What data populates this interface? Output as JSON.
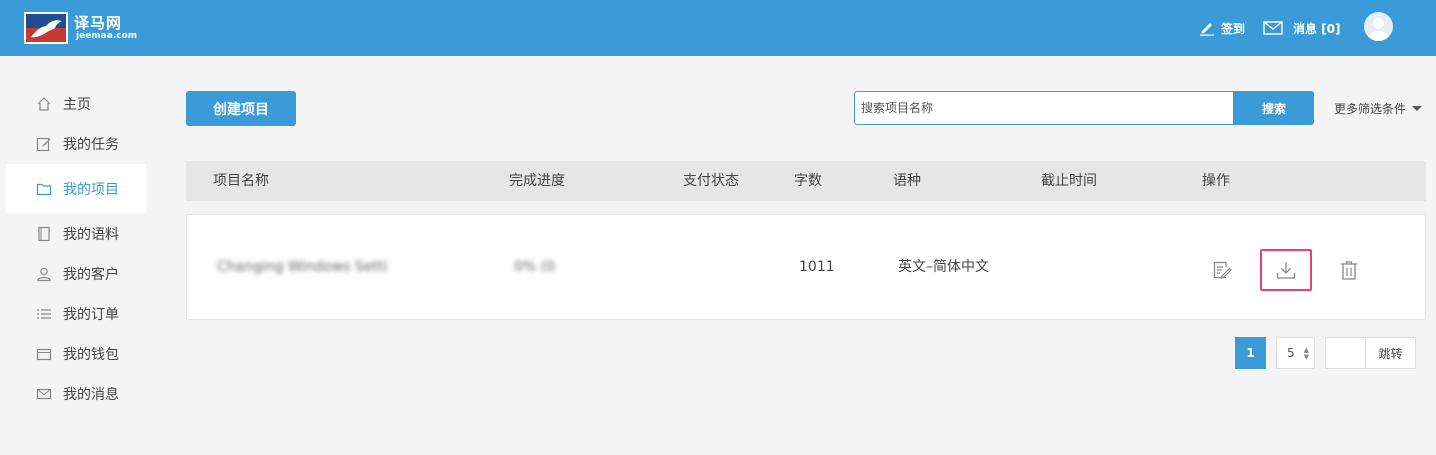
{
  "brand": {
    "name": "译马网",
    "url": "jeemaa.com"
  },
  "header": {
    "checkin_label": "签到",
    "messages_label": "消息 [0]"
  },
  "sidebar": {
    "items": [
      {
        "label": "主页",
        "icon": "home-icon",
        "active": false
      },
      {
        "label": "我的任务",
        "icon": "edit-icon",
        "active": false
      },
      {
        "label": "我的项目",
        "icon": "folder-icon",
        "active": true
      },
      {
        "label": "我的语料",
        "icon": "notebook-icon",
        "active": false
      },
      {
        "label": "我的客户",
        "icon": "user-icon",
        "active": false
      },
      {
        "label": "我的订单",
        "icon": "list-icon",
        "active": false
      },
      {
        "label": "我的钱包",
        "icon": "wallet-icon",
        "active": false
      },
      {
        "label": "我的消息",
        "icon": "mail-icon",
        "active": false
      }
    ]
  },
  "toolbar": {
    "create_label": "创建项目",
    "search_placeholder": "搜索项目名称",
    "search_label": "搜索",
    "more_filters_label": "更多筛选条件"
  },
  "table": {
    "columns": [
      "项目名称",
      "完成进度",
      "支付状态",
      "字数",
      "语种",
      "截止时间",
      "操作"
    ],
    "rows": [
      {
        "name": "Changing Windows Setti",
        "progress": "0% (0",
        "payment_status": "",
        "word_count": "1011",
        "language_pair": "英文–简体中文",
        "deadline": ""
      }
    ]
  },
  "pagination": {
    "current_page": "1",
    "page_size": "5",
    "jump_label": "跳转"
  },
  "colors": {
    "primary": "#3a9bd8",
    "highlight": "#e8407a",
    "header_bg": "#3a9bd8",
    "page_bg": "#f4f4f4"
  }
}
